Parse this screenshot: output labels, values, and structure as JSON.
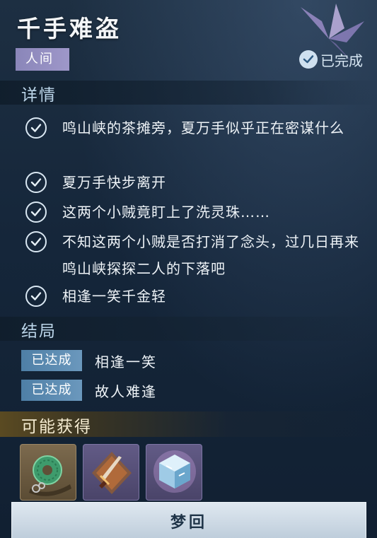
{
  "quest": {
    "title": "千手难盗",
    "realm": "人间",
    "status": "已完成"
  },
  "details": {
    "section_title": "详情",
    "items": [
      {
        "text": "鸣山峡的茶摊旁，夏万手似乎正在密谋什么"
      },
      {
        "text": "夏万手快步离开"
      },
      {
        "text": "这两个小贼竟盯上了洗灵珠……"
      },
      {
        "text": "不知这两个小贼是否打消了念头，过几日再来鸣山峡探探二人的下落吧"
      },
      {
        "text": "相逢一笑千金轻"
      }
    ]
  },
  "endings": {
    "section_title": "结局",
    "items": [
      {
        "badge": "已达成",
        "text": "相逢一笑"
      },
      {
        "badge": "已达成",
        "text": "故人难逢"
      }
    ]
  },
  "rewards": {
    "section_title": "可能获得",
    "items": [
      {
        "icon": "jade-pendant-icon"
      },
      {
        "icon": "dagger-icon"
      },
      {
        "icon": "ice-crystal-cube-icon"
      }
    ]
  },
  "action": {
    "button_label": "梦回"
  },
  "colors": {
    "realm_tag": "#9e97c9",
    "ending_badge": "#5a8ab0",
    "rewards_bar": "#5a4a22"
  }
}
